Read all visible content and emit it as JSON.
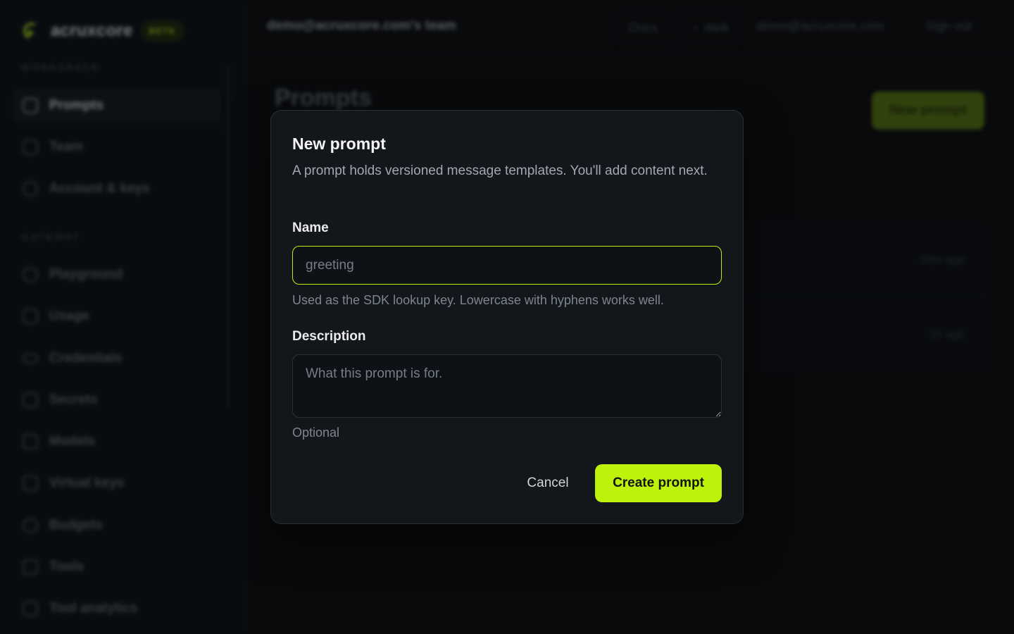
{
  "brand": {
    "name": "acruxcore",
    "badge": "BETA"
  },
  "sidebar": {
    "sections": [
      {
        "label": "WORKSPACE"
      },
      {
        "label": "GATEWAY"
      }
    ],
    "items": [
      {
        "label": "Prompts",
        "icon": "list-icon",
        "active": true
      },
      {
        "label": "Team",
        "icon": "users-icon"
      },
      {
        "label": "Account & keys",
        "icon": "key-icon"
      },
      {
        "label": "Playground",
        "icon": "play-icon"
      },
      {
        "label": "Usage",
        "icon": "chart-icon"
      },
      {
        "label": "Credentials",
        "icon": "credential-icon"
      },
      {
        "label": "Secrets",
        "icon": "lock-icon"
      },
      {
        "label": "Models",
        "icon": "cube-icon"
      },
      {
        "label": "Virtual keys",
        "icon": "link-icon"
      },
      {
        "label": "Budgets",
        "icon": "budget-icon"
      },
      {
        "label": "Tools",
        "icon": "wrench-icon"
      },
      {
        "label": "Tool analytics",
        "icon": "analytics-icon"
      }
    ]
  },
  "topbar": {
    "team": "demo@acruxcore.com's team",
    "docs": "Docs",
    "theme": "dark",
    "theme_glyph": "●",
    "email": "demo@acruxcore.com",
    "sign_out": "Sign out"
  },
  "page": {
    "title": "Prompts",
    "new_button": "New prompt",
    "rows": [
      {
        "time": "29m ago"
      },
      {
        "time": "1h ago"
      }
    ]
  },
  "modal": {
    "title": "New prompt",
    "description": "A prompt holds versioned message templates. You'll add content next.",
    "name_label": "Name",
    "name_placeholder": "greeting",
    "name_hint": "Used as the SDK lookup key. Lowercase with hyphens works well.",
    "description_label": "Description",
    "description_placeholder": "What this prompt is for.",
    "description_hint": "Optional",
    "cancel": "Cancel",
    "create": "Create prompt"
  },
  "colors": {
    "accent": "#bdf20a",
    "background": "#0b0d10",
    "modal": "#13171b"
  }
}
